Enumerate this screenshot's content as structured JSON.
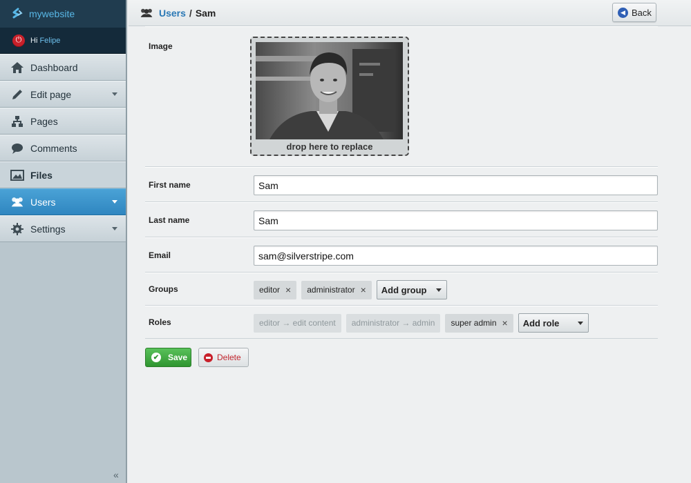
{
  "brand": {
    "name": "mywebsite"
  },
  "user": {
    "greeting": "Hi",
    "name": "Felipe"
  },
  "nav": {
    "items": [
      {
        "label": "Dashboard",
        "icon": "home-icon"
      },
      {
        "label": "Edit page",
        "icon": "pencil-icon"
      },
      {
        "label": "Pages",
        "icon": "sitemap-icon"
      },
      {
        "label": "Comments",
        "icon": "comment-icon"
      },
      {
        "label": "Files",
        "icon": "image-icon"
      },
      {
        "label": "Users",
        "icon": "users-icon"
      },
      {
        "label": "Settings",
        "icon": "gear-icon"
      }
    ]
  },
  "breadcrumb": {
    "section": "Users",
    "separator": "/",
    "current": "Sam"
  },
  "header": {
    "back_label": "Back"
  },
  "form": {
    "image_label": "Image",
    "image_drop_text": "drop here to replace",
    "first_name_label": "First name",
    "first_name_value": "Sam",
    "last_name_label": "Last name",
    "last_name_value": "Sam",
    "email_label": "Email",
    "email_value": "sam@silverstripe.com",
    "groups_label": "Groups",
    "groups": [
      "editor",
      "administrator"
    ],
    "add_group_label": "Add group",
    "roles_label": "Roles",
    "roles_inherited": [
      "editor → edit content",
      "administrator → admin"
    ],
    "roles": [
      "super admin"
    ],
    "add_role_label": "Add role"
  },
  "actions": {
    "save_label": "Save",
    "delete_label": "Delete"
  },
  "colors": {
    "accent": "#2f86c0",
    "save": "#2f9530",
    "delete": "#c8202a",
    "brand_text": "#58b7e6"
  }
}
